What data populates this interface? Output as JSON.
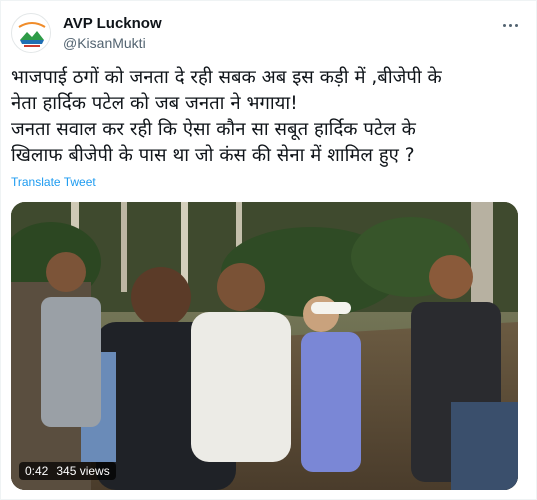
{
  "tweet": {
    "author_name": "AVP Lucknow",
    "author_handle": "@KisanMukti",
    "text_lines": [
      "भाजपाई ठगों को जनता दे रही सबक अब इस कड़ी में ,बीजेपी के",
      "नेता हार्दिक पटेल को जब जनता ने भगाया!",
      "जनता सवाल कर रही कि ऐसा कौन सा सबूत हार्दिक पटेल के",
      "खिलाफ बीजेपी के पास था जो कंस की सेना में शामिल हुए ?"
    ],
    "translate_label": "Translate Tweet"
  },
  "video": {
    "duration": "0:42",
    "views": "345 views"
  },
  "icons": {
    "more": "more-dots-icon",
    "avatar": "avatar-logo"
  },
  "colors": {
    "link": "#1d9bf0",
    "secondary_text": "#536471"
  }
}
